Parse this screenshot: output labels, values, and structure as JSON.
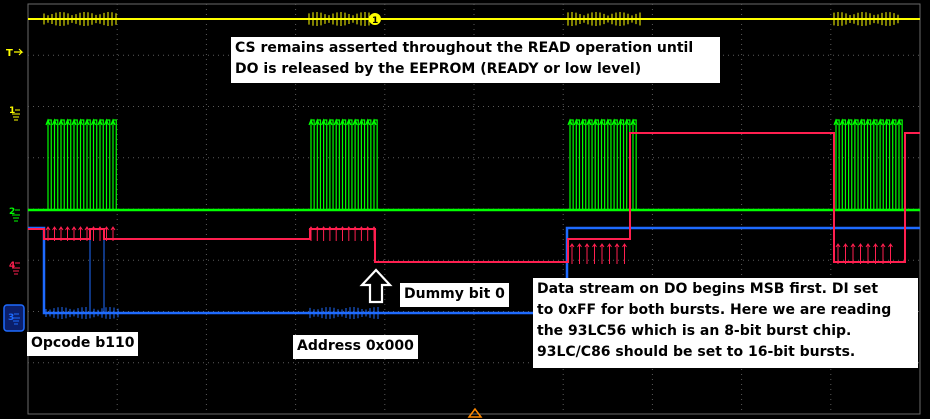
{
  "channels": [
    {
      "id": "ch1",
      "marker": "1",
      "color": "#ffff00"
    },
    {
      "id": "ch2",
      "marker": "2",
      "color": "#00ff00"
    },
    {
      "id": "ch3",
      "marker": "3",
      "color": "#1e6bff"
    },
    {
      "id": "ch4",
      "marker": "4",
      "color": "#ff1f4f"
    }
  ],
  "trigger_marker": "T",
  "top_marker": "1",
  "annotations": {
    "cs_note": [
      "CS remains asserted throughout the READ operation until",
      "DO is released by the EEPROM (READY or low level)"
    ],
    "opcode_label": "Opcode b110",
    "address_label": "Address 0x000",
    "dummy_label": "Dummy bit 0",
    "stream_note": [
      "Data stream on DO begins MSB first. DI set",
      "to 0xFF for both bursts. Here we are reading",
      "the 93LC56 which is an 8-bit burst chip.",
      "93LC/C86 should be set to 16-bit bursts."
    ]
  }
}
